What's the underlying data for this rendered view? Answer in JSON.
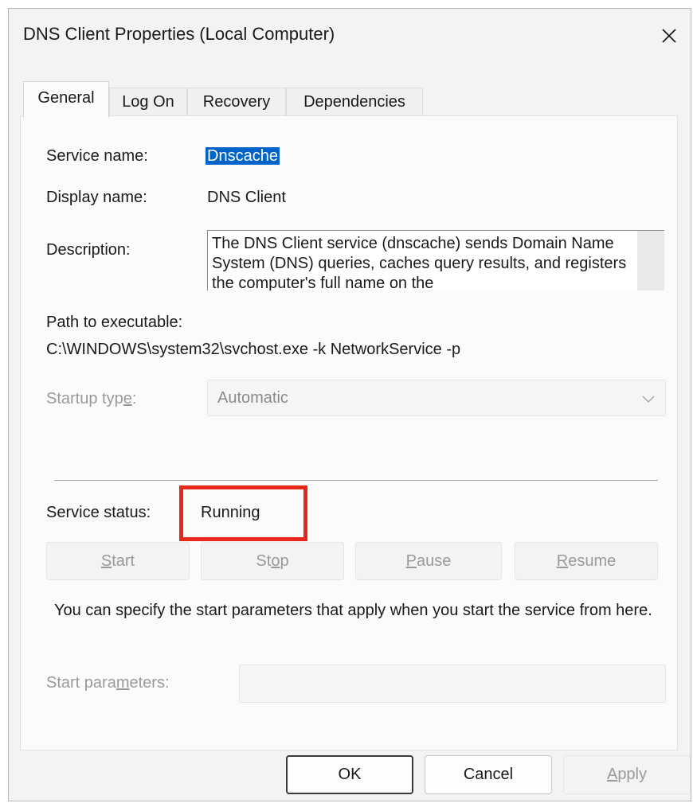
{
  "window": {
    "title": "DNS Client Properties (Local Computer)",
    "close_icon": "close-icon"
  },
  "tabs": [
    {
      "label": "General",
      "active": true
    },
    {
      "label": "Log On",
      "active": false
    },
    {
      "label": "Recovery",
      "active": false
    },
    {
      "label": "Dependencies",
      "active": false
    }
  ],
  "general": {
    "service_name_label": "Service name:",
    "service_name_value": "Dnscache",
    "display_name_label": "Display name:",
    "display_name_value": "DNS Client",
    "description_label": "Description:",
    "description_value": "The DNS Client service (dnscache) sends Domain Name System (DNS) queries, caches query results, and registers the computer's full name on the",
    "path_label": "Path to executable:",
    "path_value": "C:\\WINDOWS\\system32\\svchost.exe -k NetworkService -p",
    "startup_type_label_pre": "Startup typ",
    "startup_type_label_accel": "e",
    "startup_type_label_post": ":",
    "startup_type_value": "Automatic",
    "service_status_label": "Service status:",
    "service_status_value": "Running",
    "buttons": {
      "start": {
        "accel": "S",
        "rest": "tart"
      },
      "stop": {
        "pre": "St",
        "accel": "o",
        "post": "p"
      },
      "pause": {
        "accel": "P",
        "rest": "ause"
      },
      "resume": {
        "accel": "R",
        "rest": "esume"
      }
    },
    "info_text": "You can specify the start parameters that apply when you start the service from here.",
    "start_params_label_pre": "Start para",
    "start_params_label_accel": "m",
    "start_params_label_post": "eters:",
    "start_params_value": ""
  },
  "footer": {
    "ok_label": "OK",
    "cancel_label": "Cancel",
    "apply_accel": "A",
    "apply_rest": "pply"
  },
  "colors": {
    "selection": "#0063c8",
    "highlight_border": "#e8281b"
  }
}
